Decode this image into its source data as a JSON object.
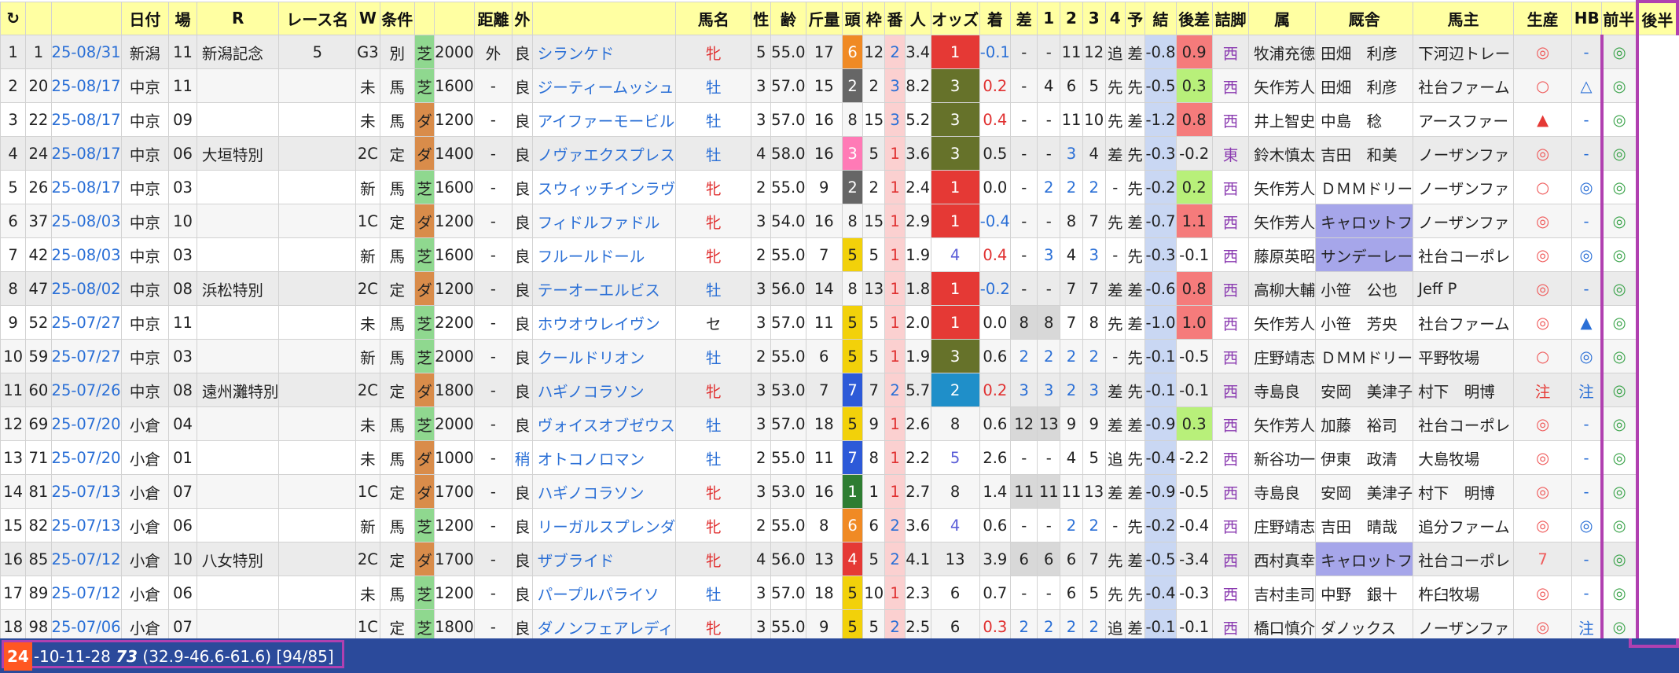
{
  "headers": {
    "reload": "↻",
    "no": "",
    "id": "",
    "date": "日付",
    "venue": "場",
    "race_no": "R",
    "race_name": "レース名",
    "w": "W",
    "cond": "条件",
    "cond2": "",
    "surface": "",
    "dist": "距離",
    "outer": "外",
    "going": "",
    "horse": "馬名",
    "sex": "性",
    "age": "齢",
    "weight": "斤量",
    "heads": "頭",
    "waku": "枠",
    "umaban": "番",
    "nin": "人",
    "odds": "オッズ",
    "chaku": "着",
    "sa": "差",
    "c1": "1",
    "c2": "2",
    "c3": "3",
    "c4": "4",
    "yo": "予",
    "ketsu": "結",
    "kosa": "後差",
    "tsume": "詰脚",
    "zoku": "属",
    "trainer": "厩舎",
    "owner": "馬主",
    "breeder": "生産",
    "hb": "HB",
    "zenhan": "前半",
    "kohan": "後半"
  },
  "rows": [
    {
      "n": "1",
      "id": "1",
      "date": "25-08/31",
      "venue": "新潟",
      "r": "11",
      "name": "新潟記念",
      "w": "5",
      "c1": "G3",
      "c2": "別",
      "sf": "芝",
      "dist": "2000",
      "out": "外",
      "go": "良",
      "horse": "シランケド",
      "sex": "牝",
      "age": "5",
      "wt": "55.0",
      "hd": "17",
      "wk": "6",
      "ub": "12",
      "nin": "2",
      "odds": "3.4",
      "ch": "1",
      "sa": "-0.1",
      "p1": "-",
      "p2": "-",
      "p3": "11",
      "p4": "12",
      "yo": "追",
      "ke": "差",
      "ks": "-0.8",
      "tm": "0.9",
      "zk": "西",
      "tr": "牧浦充徳",
      "ow": "田畑　利彦",
      "br": "下河辺トレー",
      "hb": "◎",
      "zh": "-",
      "kh": "◎"
    },
    {
      "n": "2",
      "id": "20",
      "date": "25-08/17",
      "venue": "中京",
      "r": "11",
      "name": "",
      "w": "",
      "c1": "未",
      "c2": "馬",
      "sf": "芝",
      "dist": "1600",
      "out": "-",
      "go": "良",
      "horse": "ジーティームッシュ",
      "sex": "牡",
      "age": "3",
      "wt": "57.0",
      "hd": "15",
      "wk": "2",
      "ub": "2",
      "nin": "3",
      "odds": "8.2",
      "ch": "3",
      "sa": "0.2",
      "p1": "-",
      "p2": "4",
      "p3": "6",
      "p4": "5",
      "yo": "先",
      "ke": "先",
      "ks": "-0.5",
      "tm": "0.3",
      "zk": "西",
      "tr": "矢作芳人",
      "ow": "田畑　利彦",
      "br": "社台ファーム",
      "hb": "○",
      "zh": "△",
      "kh": "◎"
    },
    {
      "n": "3",
      "id": "22",
      "date": "25-08/17",
      "venue": "中京",
      "r": "09",
      "name": "",
      "w": "",
      "c1": "未",
      "c2": "馬",
      "sf": "ダ",
      "dist": "1200",
      "out": "-",
      "go": "良",
      "horse": "アイファーモービル",
      "sex": "牡",
      "age": "3",
      "wt": "57.0",
      "hd": "16",
      "wk": "8",
      "ub": "15",
      "nin": "3",
      "odds": "5.2",
      "ch": "3",
      "sa": "0.4",
      "p1": "-",
      "p2": "-",
      "p3": "11",
      "p4": "10",
      "yo": "先",
      "ke": "差",
      "ks": "-1.2",
      "tm": "0.8",
      "zk": "西",
      "tr": "井上智史",
      "ow": "中島　稔",
      "br": "アースファー",
      "hb": "▲",
      "zh": "-",
      "kh": "◎"
    },
    {
      "n": "4",
      "id": "24",
      "date": "25-08/17",
      "venue": "中京",
      "r": "06",
      "name": "大垣特別",
      "w": "",
      "c1": "2C",
      "c2": "定",
      "sf": "ダ",
      "dist": "1400",
      "out": "-",
      "go": "良",
      "horse": "ノヴァエクスプレス",
      "sex": "牡",
      "age": "4",
      "wt": "58.0",
      "hd": "16",
      "wk": "3",
      "ub": "5",
      "nin": "1",
      "odds": "3.6",
      "ch": "3",
      "sa": "0.5",
      "p1": "-",
      "p2": "-",
      "p3": "3",
      "p4": "4",
      "yo": "差",
      "ke": "先",
      "ks": "-0.3",
      "tm": "-0.2",
      "zk": "東",
      "tr": "鈴木慎太",
      "ow": "吉田　和美",
      "br": "ノーザンファ",
      "hb": "◎",
      "zh": "-",
      "kh": "◎"
    },
    {
      "n": "5",
      "id": "26",
      "date": "25-08/17",
      "venue": "中京",
      "r": "03",
      "name": "",
      "w": "",
      "c1": "新",
      "c2": "馬",
      "sf": "芝",
      "dist": "1600",
      "out": "-",
      "go": "良",
      "horse": "スウィッチインラヴ",
      "sex": "牝",
      "age": "2",
      "wt": "55.0",
      "hd": "9",
      "wk": "2",
      "ub": "2",
      "nin": "1",
      "odds": "2.4",
      "ch": "1",
      "sa": "0.0",
      "p1": "-",
      "p2": "2",
      "p3": "2",
      "p4": "2",
      "yo": "-",
      "ke": "先",
      "ks": "-0.2",
      "tm": "0.2",
      "zk": "西",
      "tr": "矢作芳人",
      "ow": "ＤＭＭドリー",
      "br": "ノーザンファ",
      "hb": "○",
      "zh": "◎",
      "kh": "◎"
    },
    {
      "n": "6",
      "id": "37",
      "date": "25-08/03",
      "venue": "中京",
      "r": "10",
      "name": "",
      "w": "",
      "c1": "1C",
      "c2": "定",
      "sf": "ダ",
      "dist": "1200",
      "out": "-",
      "go": "良",
      "horse": "フィドルファドル",
      "sex": "牝",
      "age": "3",
      "wt": "54.0",
      "hd": "16",
      "wk": "8",
      "ub": "15",
      "nin": "1",
      "odds": "2.9",
      "ch": "1",
      "sa": "-0.4",
      "p1": "-",
      "p2": "-",
      "p3": "8",
      "p4": "7",
      "yo": "先",
      "ke": "差",
      "ks": "-0.7",
      "tm": "1.1",
      "zk": "西",
      "tr": "矢作芳人",
      "ow": "キャロットフ",
      "br": "ノーザンファ",
      "hb": "◎",
      "zh": "-",
      "kh": "◎"
    },
    {
      "n": "7",
      "id": "42",
      "date": "25-08/03",
      "venue": "中京",
      "r": "03",
      "name": "",
      "w": "",
      "c1": "新",
      "c2": "馬",
      "sf": "芝",
      "dist": "1600",
      "out": "-",
      "go": "良",
      "horse": "フルールドール",
      "sex": "牝",
      "age": "2",
      "wt": "55.0",
      "hd": "7",
      "wk": "5",
      "ub": "5",
      "nin": "1",
      "odds": "1.9",
      "ch": "4",
      "sa": "0.4",
      "p1": "-",
      "p2": "3",
      "p3": "4",
      "p4": "3",
      "yo": "-",
      "ke": "先",
      "ks": "-0.3",
      "tm": "-0.1",
      "zk": "西",
      "tr": "藤原英昭",
      "ow": "サンデーレー",
      "br": "社台コーポレ",
      "hb": "◎",
      "zh": "◎",
      "kh": "◎"
    },
    {
      "n": "8",
      "id": "47",
      "date": "25-08/02",
      "venue": "中京",
      "r": "08",
      "name": "浜松特別",
      "w": "",
      "c1": "2C",
      "c2": "定",
      "sf": "ダ",
      "dist": "1200",
      "out": "-",
      "go": "良",
      "horse": "テーオーエルビス",
      "sex": "牡",
      "age": "3",
      "wt": "56.0",
      "hd": "14",
      "wk": "8",
      "ub": "13",
      "nin": "1",
      "odds": "1.8",
      "ch": "1",
      "sa": "-0.2",
      "p1": "-",
      "p2": "-",
      "p3": "7",
      "p4": "7",
      "yo": "差",
      "ke": "差",
      "ks": "-0.6",
      "tm": "0.8",
      "zk": "西",
      "tr": "高柳大輔",
      "ow": "小笹　公也",
      "br": "Jeff P",
      "hb": "◎",
      "zh": "-",
      "kh": "◎"
    },
    {
      "n": "9",
      "id": "52",
      "date": "25-07/27",
      "venue": "中京",
      "r": "11",
      "name": "",
      "w": "",
      "c1": "未",
      "c2": "馬",
      "sf": "芝",
      "dist": "2200",
      "out": "-",
      "go": "良",
      "horse": "ホウオウレイヴン",
      "sex": "セ",
      "age": "3",
      "wt": "57.0",
      "hd": "11",
      "wk": "5",
      "ub": "5",
      "nin": "1",
      "odds": "2.0",
      "ch": "1",
      "sa": "0.0",
      "p1": "8",
      "p2": "8",
      "p3": "7",
      "p4": "8",
      "yo": "先",
      "ke": "差",
      "ks": "-1.0",
      "tm": "1.0",
      "zk": "西",
      "tr": "矢作芳人",
      "ow": "小笹　芳央",
      "br": "社台ファーム",
      "hb": "◎",
      "zh": "▲",
      "kh": "◎"
    },
    {
      "n": "10",
      "id": "59",
      "date": "25-07/27",
      "venue": "中京",
      "r": "03",
      "name": "",
      "w": "",
      "c1": "新",
      "c2": "馬",
      "sf": "芝",
      "dist": "2000",
      "out": "-",
      "go": "良",
      "horse": "クールドリオン",
      "sex": "牡",
      "age": "2",
      "wt": "55.0",
      "hd": "6",
      "wk": "5",
      "ub": "5",
      "nin": "1",
      "odds": "1.9",
      "ch": "3",
      "sa": "0.6",
      "p1": "2",
      "p2": "2",
      "p3": "2",
      "p4": "2",
      "yo": "-",
      "ke": "先",
      "ks": "-0.1",
      "tm": "-0.5",
      "zk": "西",
      "tr": "庄野靖志",
      "ow": "ＤＭＭドリー",
      "br": "平野牧場",
      "hb": "○",
      "zh": "◎",
      "kh": "◎"
    },
    {
      "n": "11",
      "id": "60",
      "date": "25-07/26",
      "venue": "中京",
      "r": "08",
      "name": "遠州灘特別",
      "w": "",
      "c1": "2C",
      "c2": "定",
      "sf": "ダ",
      "dist": "1800",
      "out": "-",
      "go": "良",
      "horse": "ハギノコラソン",
      "sex": "牝",
      "age": "3",
      "wt": "53.0",
      "hd": "7",
      "wk": "7",
      "ub": "7",
      "nin": "2",
      "odds": "5.7",
      "ch": "2",
      "sa": "0.2",
      "p1": "3",
      "p2": "3",
      "p3": "2",
      "p4": "3",
      "yo": "差",
      "ke": "先",
      "ks": "-0.1",
      "tm": "-0.1",
      "zk": "西",
      "tr": "寺島良",
      "ow": "安岡　美津子",
      "br": "村下　明博",
      "hb": "注",
      "zh": "注",
      "kh": "◎"
    },
    {
      "n": "12",
      "id": "69",
      "date": "25-07/20",
      "venue": "小倉",
      "r": "04",
      "name": "",
      "w": "",
      "c1": "未",
      "c2": "馬",
      "sf": "芝",
      "dist": "2000",
      "out": "-",
      "go": "良",
      "horse": "ヴォイスオブゼウス",
      "sex": "牡",
      "age": "3",
      "wt": "57.0",
      "hd": "18",
      "wk": "5",
      "ub": "9",
      "nin": "1",
      "odds": "2.6",
      "ch": "8",
      "sa": "0.6",
      "p1": "12",
      "p2": "13",
      "p3": "9",
      "p4": "9",
      "yo": "差",
      "ke": "差",
      "ks": "-0.9",
      "tm": "0.3",
      "zk": "西",
      "tr": "矢作芳人",
      "ow": "加藤　裕司",
      "br": "社台コーポレ",
      "hb": "◎",
      "zh": "-",
      "kh": "◎"
    },
    {
      "n": "13",
      "id": "71",
      "date": "25-07/20",
      "venue": "小倉",
      "r": "01",
      "name": "",
      "w": "",
      "c1": "未",
      "c2": "馬",
      "sf": "ダ",
      "dist": "1000",
      "out": "-",
      "go": "稍",
      "horse": "オトコノロマン",
      "sex": "牡",
      "age": "2",
      "wt": "55.0",
      "hd": "11",
      "wk": "7",
      "ub": "8",
      "nin": "1",
      "odds": "2.2",
      "ch": "5",
      "sa": "2.6",
      "p1": "-",
      "p2": "-",
      "p3": "4",
      "p4": "5",
      "yo": "追",
      "ke": "先",
      "ks": "-0.4",
      "tm": "-2.2",
      "zk": "西",
      "tr": "新谷功一",
      "ow": "伊東　政清",
      "br": "大島牧場",
      "hb": "◎",
      "zh": "-",
      "kh": "◎"
    },
    {
      "n": "14",
      "id": "81",
      "date": "25-07/13",
      "venue": "小倉",
      "r": "07",
      "name": "",
      "w": "",
      "c1": "1C",
      "c2": "定",
      "sf": "ダ",
      "dist": "1700",
      "out": "-",
      "go": "良",
      "horse": "ハギノコラソン",
      "sex": "牝",
      "age": "3",
      "wt": "53.0",
      "hd": "16",
      "wk": "1",
      "ub": "1",
      "nin": "1",
      "odds": "2.7",
      "ch": "8",
      "sa": "1.4",
      "p1": "11",
      "p2": "11",
      "p3": "11",
      "p4": "13",
      "yo": "差",
      "ke": "差",
      "ks": "-0.9",
      "tm": "-0.5",
      "zk": "西",
      "tr": "寺島良",
      "ow": "安岡　美津子",
      "br": "村下　明博",
      "hb": "◎",
      "zh": "-",
      "kh": "◎"
    },
    {
      "n": "15",
      "id": "82",
      "date": "25-07/13",
      "venue": "小倉",
      "r": "06",
      "name": "",
      "w": "",
      "c1": "新",
      "c2": "馬",
      "sf": "芝",
      "dist": "1200",
      "out": "-",
      "go": "良",
      "horse": "リーガルスプレンダ",
      "sex": "牝",
      "age": "2",
      "wt": "55.0",
      "hd": "8",
      "wk": "6",
      "ub": "6",
      "nin": "2",
      "odds": "3.6",
      "ch": "4",
      "sa": "0.6",
      "p1": "-",
      "p2": "-",
      "p3": "2",
      "p4": "2",
      "yo": "-",
      "ke": "先",
      "ks": "-0.2",
      "tm": "-0.4",
      "zk": "西",
      "tr": "庄野靖志",
      "ow": "吉田　晴哉",
      "br": "追分ファーム",
      "hb": "◎",
      "zh": "◎",
      "kh": "◎"
    },
    {
      "n": "16",
      "id": "85",
      "date": "25-07/12",
      "venue": "小倉",
      "r": "10",
      "name": "八女特別",
      "w": "",
      "c1": "2C",
      "c2": "定",
      "sf": "ダ",
      "dist": "1700",
      "out": "-",
      "go": "良",
      "horse": "ザブライド",
      "sex": "牝",
      "age": "4",
      "wt": "56.0",
      "hd": "13",
      "wk": "4",
      "ub": "5",
      "nin": "2",
      "odds": "4.1",
      "ch": "13",
      "sa": "3.9",
      "p1": "6",
      "p2": "6",
      "p3": "6",
      "p4": "7",
      "yo": "先",
      "ke": "差",
      "ks": "-0.5",
      "tm": "-3.4",
      "zk": "西",
      "tr": "西村真幸",
      "ow": "キャロットフ",
      "br": "社台コーポレ",
      "hb": "7",
      "zh": "-",
      "kh": "◎"
    },
    {
      "n": "17",
      "id": "89",
      "date": "25-07/12",
      "venue": "小倉",
      "r": "06",
      "name": "",
      "w": "",
      "c1": "未",
      "c2": "馬",
      "sf": "芝",
      "dist": "1200",
      "out": "-",
      "go": "良",
      "horse": "パープルパライソ",
      "sex": "牡",
      "age": "3",
      "wt": "57.0",
      "hd": "18",
      "wk": "5",
      "ub": "10",
      "nin": "1",
      "odds": "2.3",
      "ch": "6",
      "sa": "0.7",
      "p1": "-",
      "p2": "-",
      "p3": "6",
      "p4": "5",
      "yo": "先",
      "ke": "先",
      "ks": "-0.4",
      "tm": "-0.3",
      "zk": "西",
      "tr": "吉村圭司",
      "ow": "中野　銀十",
      "br": "杵臼牧場",
      "hb": "◎",
      "zh": "-",
      "kh": "◎"
    },
    {
      "n": "18",
      "id": "98",
      "date": "25-07/06",
      "venue": "小倉",
      "r": "07",
      "name": "",
      "w": "",
      "c1": "1C",
      "c2": "定",
      "sf": "芝",
      "dist": "1800",
      "out": "-",
      "go": "良",
      "horse": "ダノンフェアレディ",
      "sex": "牝",
      "age": "3",
      "wt": "55.0",
      "hd": "9",
      "wk": "5",
      "ub": "5",
      "nin": "2",
      "odds": "2.5",
      "ch": "6",
      "sa": "0.3",
      "p1": "2",
      "p2": "2",
      "p3": "2",
      "p4": "2",
      "yo": "追",
      "ke": "差",
      "ks": "-0.1",
      "tm": "-0.1",
      "zk": "西",
      "tr": "橋口慎介",
      "ow": "ダノックス",
      "br": "ノーザンファ",
      "hb": "◎",
      "zh": "注",
      "kh": "◎"
    }
  ],
  "status": {
    "badge": "24",
    "date": "-10-11-28",
    "score": "73",
    "detail": "(32.9-46.6-61.6) [94/85]"
  },
  "colors": {
    "header_bg": "#ffffa2",
    "link_blue": "#2a6fd6",
    "female_red": "#e03030",
    "turf_green": "#8fd88f",
    "dirt_orange": "#d98c4a",
    "highlight_purple": "#b040b0",
    "status_bg": "#2b4a9b"
  }
}
